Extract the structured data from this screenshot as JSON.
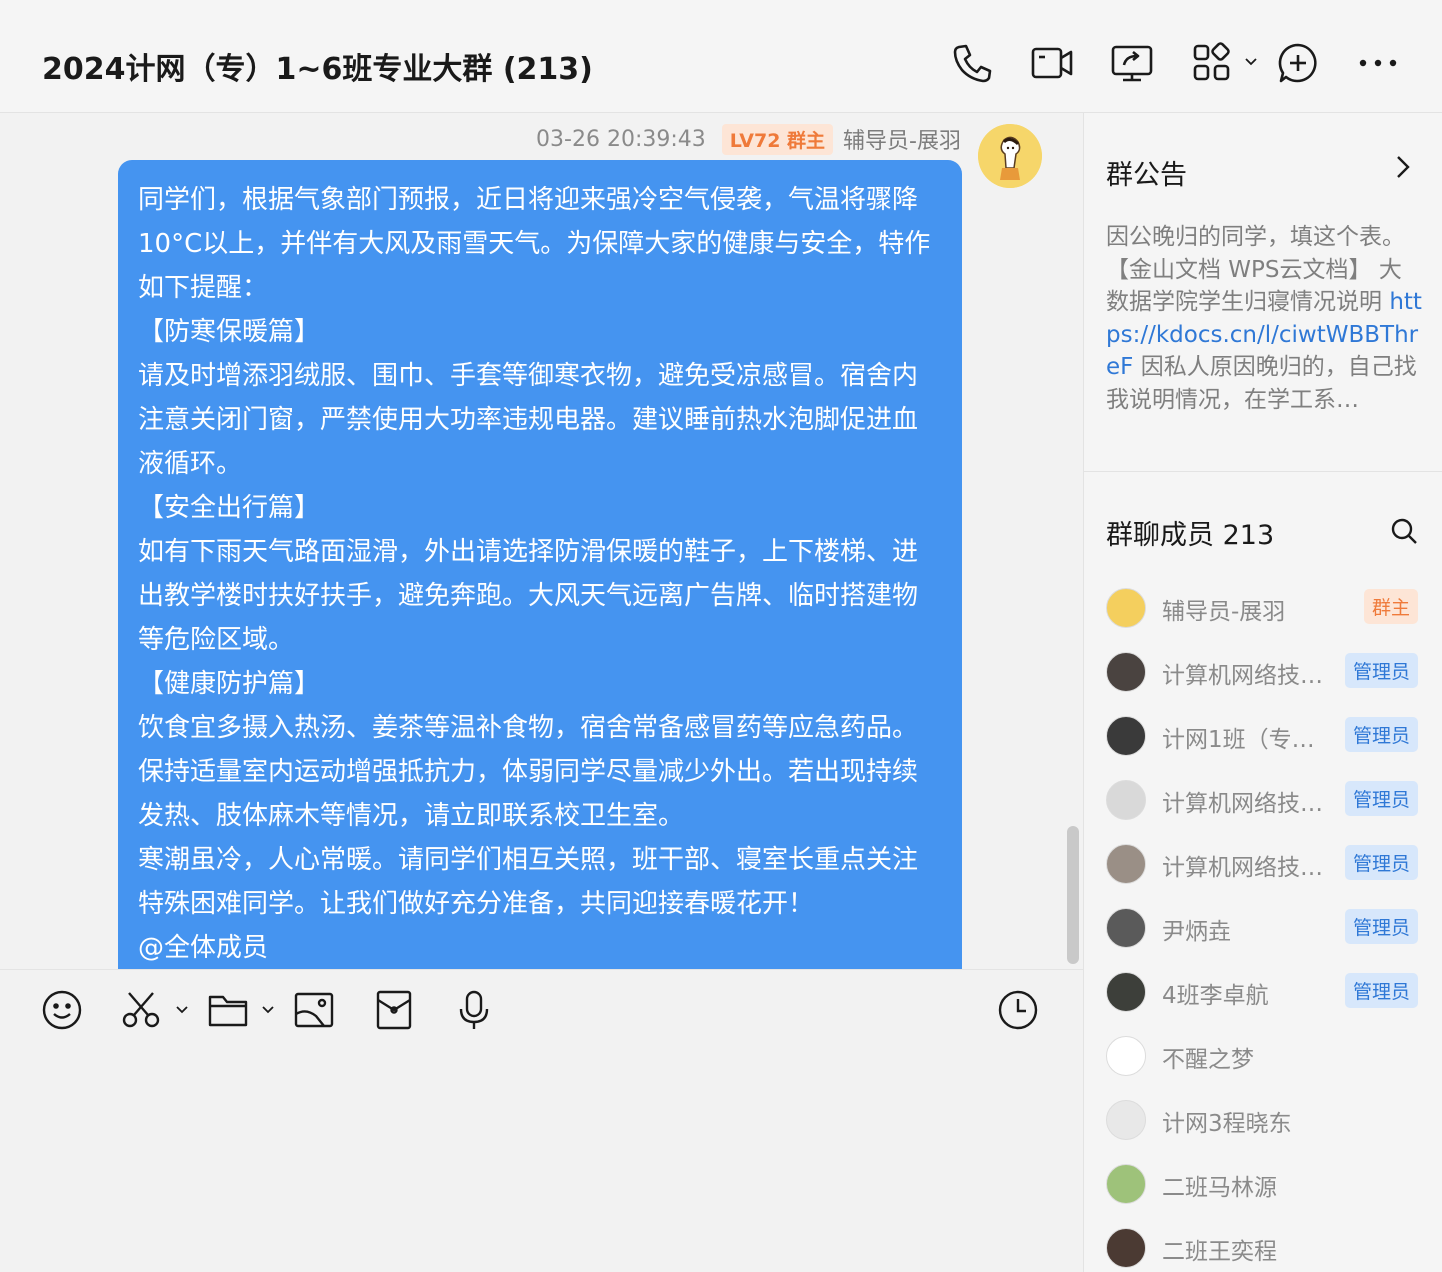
{
  "header": {
    "title": "2024计网（专）1~6班专业大群 (213)"
  },
  "message": {
    "time": "03-26 20:39:43",
    "level_badge": "LV72 群主",
    "sender": "辅导员-展羽",
    "lines": [
      "同学们，根据气象部门预报，近日将迎来强冷空气侵袭，气温将骤降10°C以上，并伴有大风及雨雪天气。为保障大家的健康与安全，特作如下提醒：",
      "【防寒保暖篇】",
      "请及时增添羽绒服、围巾、手套等御寒衣物，避免受凉感冒。宿舍内注意关闭门窗，严禁使用大功率违规电器。建议睡前热水泡脚促进血液循环。",
      "【安全出行篇】",
      "如有下雨天气路面湿滑，外出请选择防滑保暖的鞋子，上下楼梯、进出教学楼时扶好扶手，避免奔跑。大风天气远离广告牌、临时搭建物等危险区域。",
      "【健康防护篇】",
      "饮食宜多摄入热汤、姜茶等温补食物，宿舍常备感冒药等应急药品。保持适量室内运动增强抵抗力，体弱同学尽量减少外出。若出现持续发热、肢体麻木等情况，请立即联系校卫生室。",
      "寒潮虽冷，人心常暖。请同学们相互关照，班干部、寝室长重点关注特殊困难同学。让我们做好充分准备，共同迎接春暖花开！",
      "@全体成员"
    ]
  },
  "sidebar": {
    "notice_title": "群公告",
    "notice_text_before": "因公晚归的同学，填这个表。【金山文档 WPS云文档】 大数据学院学生归寝情况说明 ",
    "notice_link": "https://kdocs.cn/l/ciwtWBBThreF",
    "notice_text_after": " 因私人原因晚归的，自己找我说明情况，在学工系…",
    "members_title": "群聊成员 213",
    "members": [
      {
        "name": "辅导员-展羽",
        "tag": "群主",
        "tag_type": "owner",
        "avatar_color": "#f4cf5e"
      },
      {
        "name": "计算机网络技…",
        "tag": "管理员",
        "tag_type": "admin",
        "avatar_color": "#4a4340"
      },
      {
        "name": "计网1班（专…",
        "tag": "管理员",
        "tag_type": "admin",
        "avatar_color": "#3a3a3a"
      },
      {
        "name": "计算机网络技…",
        "tag": "管理员",
        "tag_type": "admin",
        "avatar_color": "#d9d9d9"
      },
      {
        "name": "计算机网络技…",
        "tag": "管理员",
        "tag_type": "admin",
        "avatar_color": "#9a8f86"
      },
      {
        "name": "尹炳垚",
        "tag": "管理员",
        "tag_type": "admin",
        "avatar_color": "#5a5a5a"
      },
      {
        "name": "4班李卓航",
        "tag": "管理员",
        "tag_type": "admin",
        "avatar_color": "#3d3f3a"
      },
      {
        "name": "不醒之梦",
        "tag": "",
        "tag_type": "",
        "avatar_color": "#ffffff"
      },
      {
        "name": "计网3程晓东",
        "tag": "",
        "tag_type": "",
        "avatar_color": "#e8e8e8"
      },
      {
        "name": "二班马林源",
        "tag": "",
        "tag_type": "",
        "avatar_color": "#9ec27a"
      },
      {
        "name": "二班王奕程",
        "tag": "",
        "tag_type": "",
        "avatar_color": "#4b3a33"
      }
    ]
  },
  "colors": {
    "bubble": "#4594f0",
    "link": "#2f78d6",
    "owner_tag": "#ef7a3a",
    "admin_tag": "#2f78d6"
  },
  "icons": {
    "header": [
      "phone-icon",
      "video-call-icon",
      "screen-share-icon",
      "apps-icon",
      "add-member-icon",
      "more-icon"
    ],
    "toolbar": [
      "emoji-icon",
      "scissors-icon",
      "folder-icon",
      "image-icon",
      "red-packet-icon",
      "microphone-icon",
      "history-icon"
    ]
  }
}
